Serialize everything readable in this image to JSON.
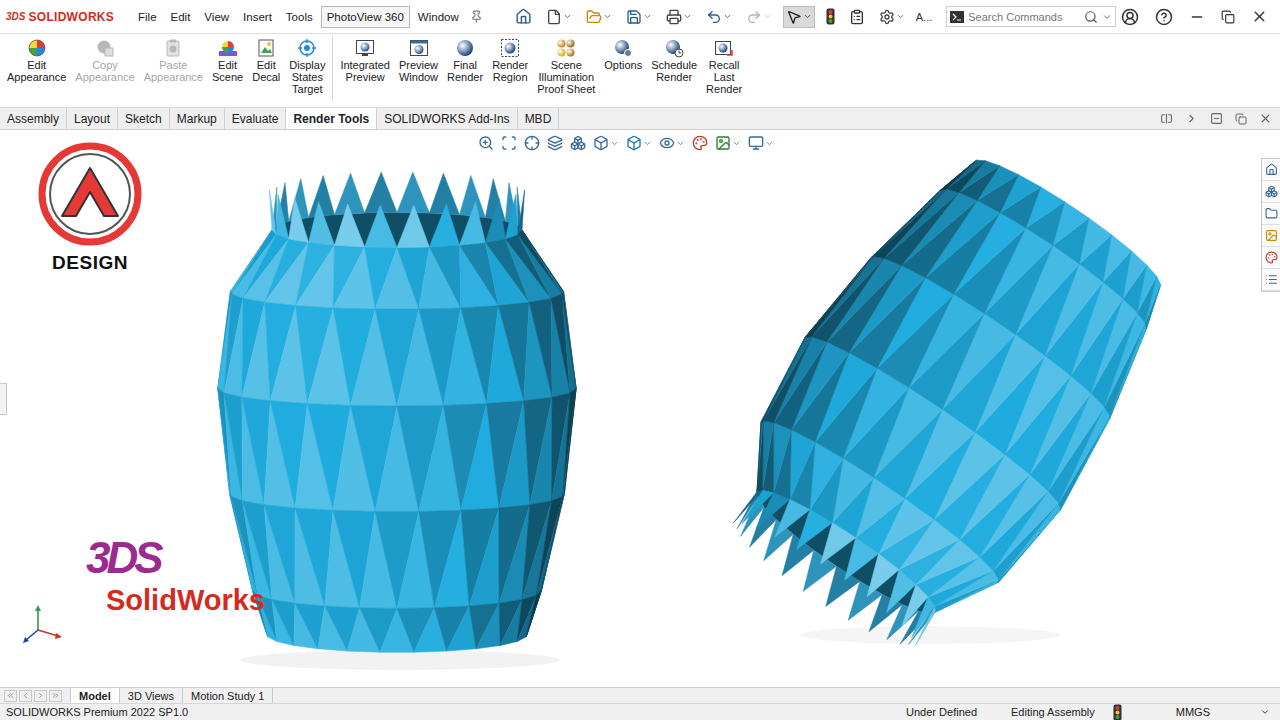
{
  "app": {
    "mark": "3DS",
    "name": "SOLIDWORKS"
  },
  "menu": [
    {
      "label": "File",
      "selected": false
    },
    {
      "label": "Edit",
      "selected": false
    },
    {
      "label": "View",
      "selected": false
    },
    {
      "label": "Insert",
      "selected": false
    },
    {
      "label": "Tools",
      "selected": false
    },
    {
      "label": "PhotoView 360",
      "selected": true
    },
    {
      "label": "Window",
      "selected": false
    }
  ],
  "toolbar_overflow": "A...",
  "search": {
    "placeholder": "Search Commands"
  },
  "ribbon_groups": [
    [
      {
        "lines": [
          "Edit",
          "Appearance"
        ],
        "disabled": false
      },
      {
        "lines": [
          "Copy",
          "Appearance"
        ],
        "disabled": true
      },
      {
        "lines": [
          "Paste",
          "Appearance"
        ],
        "disabled": true
      },
      {
        "lines": [
          "Edit",
          "Scene"
        ],
        "disabled": false
      },
      {
        "lines": [
          "Edit",
          "Decal"
        ],
        "disabled": false
      },
      {
        "lines": [
          "Display",
          "States",
          "Target"
        ],
        "disabled": false
      }
    ],
    [
      {
        "lines": [
          "Integrated",
          "Preview"
        ],
        "disabled": false
      },
      {
        "lines": [
          "Preview",
          "Window"
        ],
        "disabled": false
      },
      {
        "lines": [
          "Final",
          "Render"
        ],
        "disabled": false
      },
      {
        "lines": [
          "Render",
          "Region"
        ],
        "disabled": false
      },
      {
        "lines": [
          "Scene",
          "Illumination",
          "Proof Sheet"
        ],
        "disabled": false
      },
      {
        "lines": [
          "Options"
        ],
        "disabled": false
      },
      {
        "lines": [
          "Schedule",
          "Render"
        ],
        "disabled": false
      },
      {
        "lines": [
          "Recall",
          "Last",
          "Render"
        ],
        "disabled": false
      }
    ]
  ],
  "tabs": [
    {
      "label": "Assembly",
      "selected": false
    },
    {
      "label": "Layout",
      "selected": false
    },
    {
      "label": "Sketch",
      "selected": false
    },
    {
      "label": "Markup",
      "selected": false
    },
    {
      "label": "Evaluate",
      "selected": false
    },
    {
      "label": "Render Tools",
      "selected": true
    },
    {
      "label": "SOLIDWORKS Add-Ins",
      "selected": false
    },
    {
      "label": "MBD",
      "selected": false
    }
  ],
  "watermark": {
    "brand": "DESIGN",
    "mark": "3DS",
    "product": "SolidWorks"
  },
  "document_tabs": [
    {
      "label": "Model",
      "selected": true
    },
    {
      "label": "3D Views",
      "selected": false
    },
    {
      "label": "Motion Study 1",
      "selected": false
    }
  ],
  "status_bar": {
    "product": "SOLIDWORKS Premium 2022 SP1.0",
    "definition": "Under Defined",
    "mode": "Editing Assembly",
    "units": "MMGS"
  }
}
